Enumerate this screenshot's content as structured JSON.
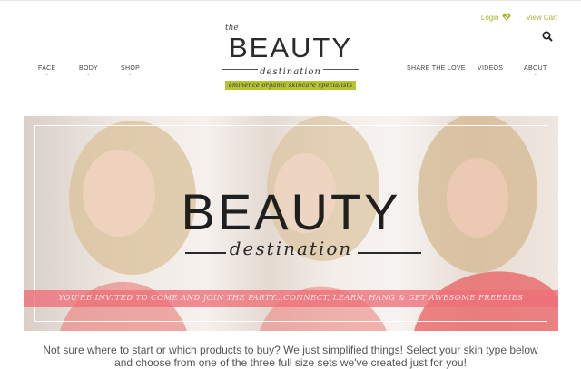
{
  "header": {
    "login_label": "Login",
    "cart_label": "View Cart",
    "heart_icon": "heart-check-icon",
    "search_icon": "search-icon"
  },
  "logo": {
    "the": "the",
    "title": "BEAUTY",
    "script": "destination",
    "tagline": "eminence organic skincare specialists"
  },
  "nav": {
    "left": [
      "FACE",
      "BODY",
      "SHOP"
    ],
    "right": [
      "SHARE THE LOVE",
      "VIDEOS",
      "ABOUT"
    ]
  },
  "hero": {
    "title": "BEAUTY",
    "script": "destination",
    "banner": "YOU'RE INVITED TO COME AND JOIN THE PARTY...CONNECT, LEARN, HANG & GET AWESOME FREEBIES"
  },
  "intro": {
    "line1": "Not sure where to start or which products to buy?  We just simplified things! Select your skin type below",
    "line2": "and choose from one of the three full size sets we've created just for you!"
  },
  "colors": {
    "accent": "#a9b22c",
    "tagline_bg": "#b5c335",
    "banner": "#ee6e78"
  }
}
